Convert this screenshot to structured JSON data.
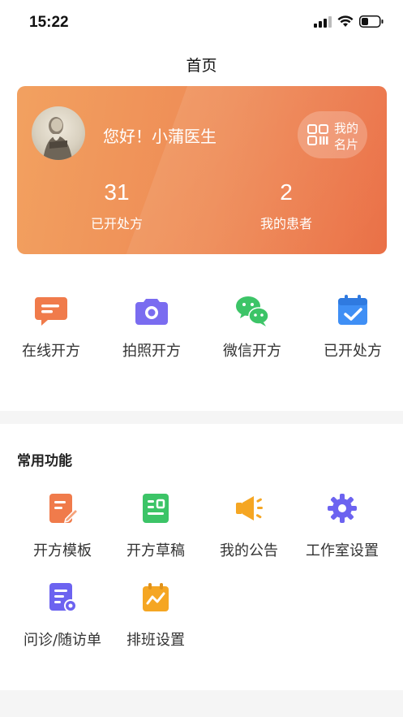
{
  "status_bar": {
    "time": "15:22"
  },
  "nav": {
    "title": "首页"
  },
  "doctor_card": {
    "greeting": "您好！小蒲医生",
    "card_button_label": "我的名片",
    "stats": [
      {
        "value": "31",
        "label": "已开处方"
      },
      {
        "value": "2",
        "label": "我的患者"
      }
    ],
    "colors": {
      "gradient_start": "#f2a160",
      "gradient_end": "#ea6e44"
    }
  },
  "quick_actions": [
    {
      "label": "在线开方",
      "icon": "chat-bubble-icon",
      "color": "#f07b4b"
    },
    {
      "label": "拍照开方",
      "icon": "camera-icon",
      "color": "#7a6cf0"
    },
    {
      "label": "微信开方",
      "icon": "wechat-icon",
      "color": "#3cc467"
    },
    {
      "label": "已开处方",
      "icon": "calendar-check-icon",
      "color": "#3f8ff5"
    }
  ],
  "common_functions": {
    "title": "常用功能",
    "items": [
      {
        "label": "开方模板",
        "icon": "edit-document-icon",
        "color": "#f07b4b"
      },
      {
        "label": "开方草稿",
        "icon": "draft-icon",
        "color": "#3cc467"
      },
      {
        "label": "我的公告",
        "icon": "megaphone-icon",
        "color": "#f5a623"
      },
      {
        "label": "工作室设置",
        "icon": "gear-icon",
        "color": "#6c63f0"
      },
      {
        "label": "问诊/随访单",
        "icon": "form-settings-icon",
        "color": "#6c63f0"
      },
      {
        "label": "排班设置",
        "icon": "schedule-icon",
        "color": "#f5a623"
      }
    ]
  }
}
